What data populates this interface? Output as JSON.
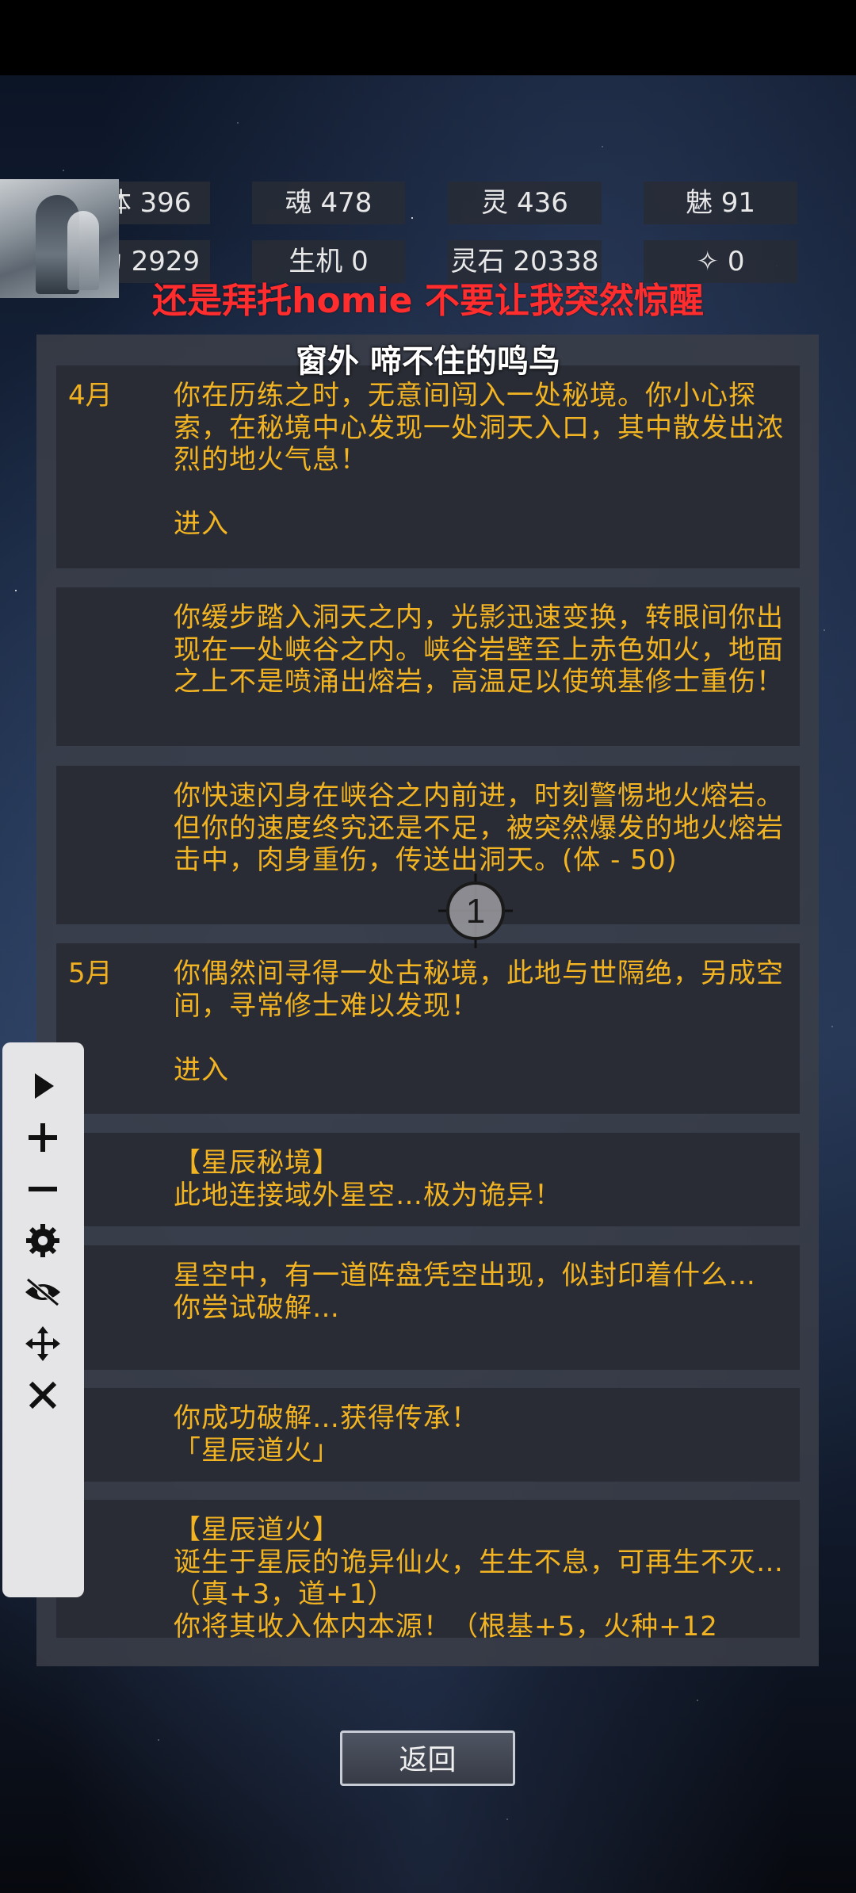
{
  "stats_row1": [
    {
      "label": "体",
      "value": "396"
    },
    {
      "label": "魂",
      "value": "478"
    },
    {
      "label": "灵",
      "value": "436"
    },
    {
      "label": "魅",
      "value": "91"
    }
  ],
  "stats_row2": [
    {
      "label": "为",
      "value": "2929"
    },
    {
      "label": "生机",
      "value": "0"
    },
    {
      "label": "灵石",
      "value": "20338"
    },
    {
      "label": "✧",
      "value": "0"
    }
  ],
  "headline": "还是拜托homie 不要让我突然惊醒",
  "subtitle": "窗外 啼不住的鸣鸟",
  "entries": [
    {
      "month": "4月",
      "text": "你在历练之时，无意间闯入一处秘境。你小心探索，在秘境中心发现一处洞天入口，其中散发出浓烈的地火气息！\n\n进入"
    },
    {
      "month": "",
      "text": "你缓步踏入洞天之内，光影迅速变换，转眼间你出现在一处峡谷之内。峡谷岩壁至上赤色如火，地面之上不是喷涌出熔岩，高温足以使筑基修士重伤！"
    },
    {
      "month": "",
      "text": "你快速闪身在峡谷之内前进，时刻警惕地火熔岩。但你的速度终究还是不足，被突然爆发的地火熔岩击中，肉身重伤，传送出洞天。(体 - 50)"
    },
    {
      "month": "5月",
      "text": "你偶然间寻得一处古秘境，此地与世隔绝，另成空间，寻常修士难以发现！\n\n进入"
    },
    {
      "month": "",
      "text": "【星辰秘境】\n此地连接域外星空…极为诡异！"
    },
    {
      "month": "",
      "text": "星空中，有一道阵盘凭空出现，似封印着什么…\n你尝试破解…"
    },
    {
      "month": "",
      "text": "你成功破解…获得传承！\n「星辰道火」"
    },
    {
      "month": "",
      "text": "【星辰道火】\n诞生于星辰的诡异仙火，生生不息，可再生不灭…（真+3，道+1）\n你将其收入体内本源！（根基+5，火种+12"
    }
  ],
  "crosshair_label": "1",
  "toolbar": {
    "icons": [
      "play-icon",
      "plus-icon",
      "minus-icon",
      "gear-icon",
      "eye-off-icon",
      "move-icon",
      "close-icon"
    ]
  },
  "back_button": "返回",
  "colors": {
    "text_gold": "#f2b422",
    "headline_red": "#ff2d2d",
    "entry_bg": "#292c34",
    "panel_bg": "#3a3e48"
  }
}
